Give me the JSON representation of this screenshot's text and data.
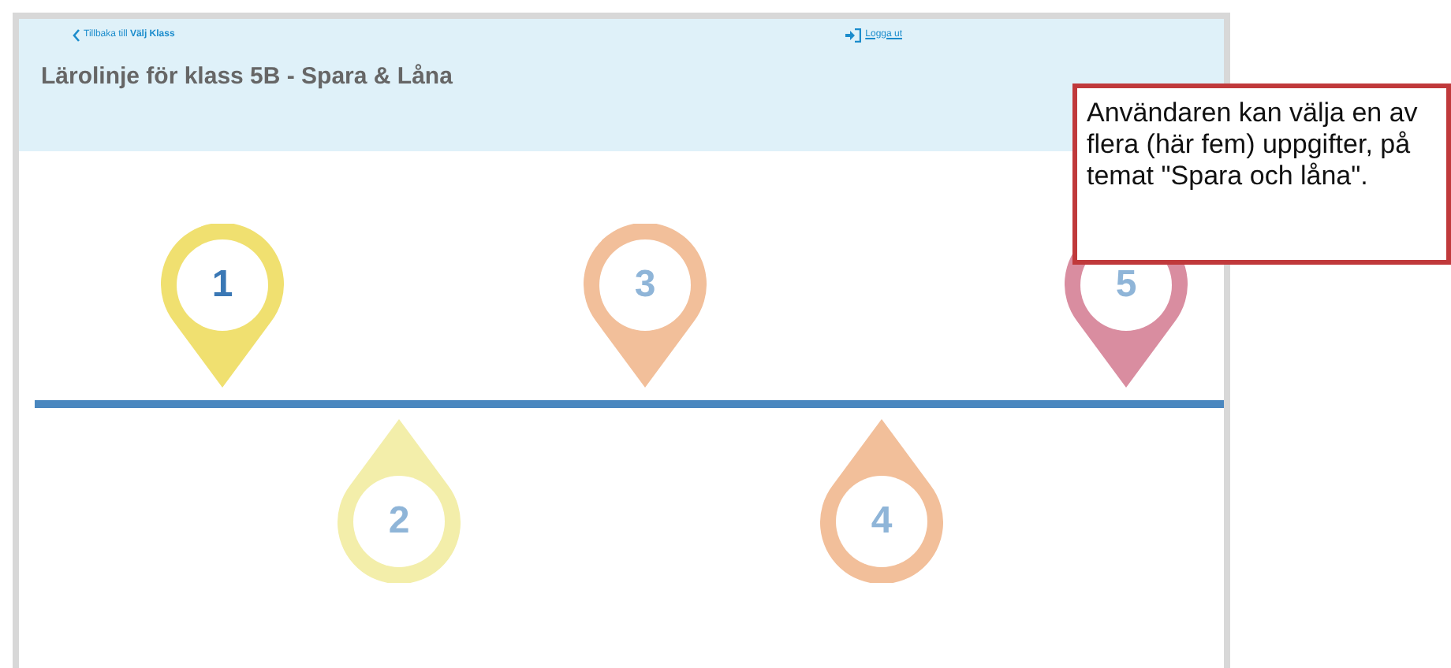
{
  "header": {
    "back_link": "Tillbaka till **Välj Klass**",
    "logout_link": "Logga ut",
    "title": "Lärolinje för klass 5B - Spara & Låna"
  },
  "timeline": {
    "pins": [
      {
        "number": "1",
        "kind": "up",
        "color": "#f0e070",
        "selected": true
      },
      {
        "number": "2",
        "kind": "down",
        "color": "#f3eeaa",
        "selected": false
      },
      {
        "number": "3",
        "kind": "up",
        "color": "#f2bf9a",
        "selected": false
      },
      {
        "number": "4",
        "kind": "down",
        "color": "#f2bf9a",
        "selected": false
      },
      {
        "number": "5",
        "kind": "up",
        "color": "#d98da0",
        "selected": false
      }
    ]
  },
  "callout": {
    "text": "Användaren kan välja en av flera (här fem) uppgifter, på temat \"Spara och låna\"."
  }
}
